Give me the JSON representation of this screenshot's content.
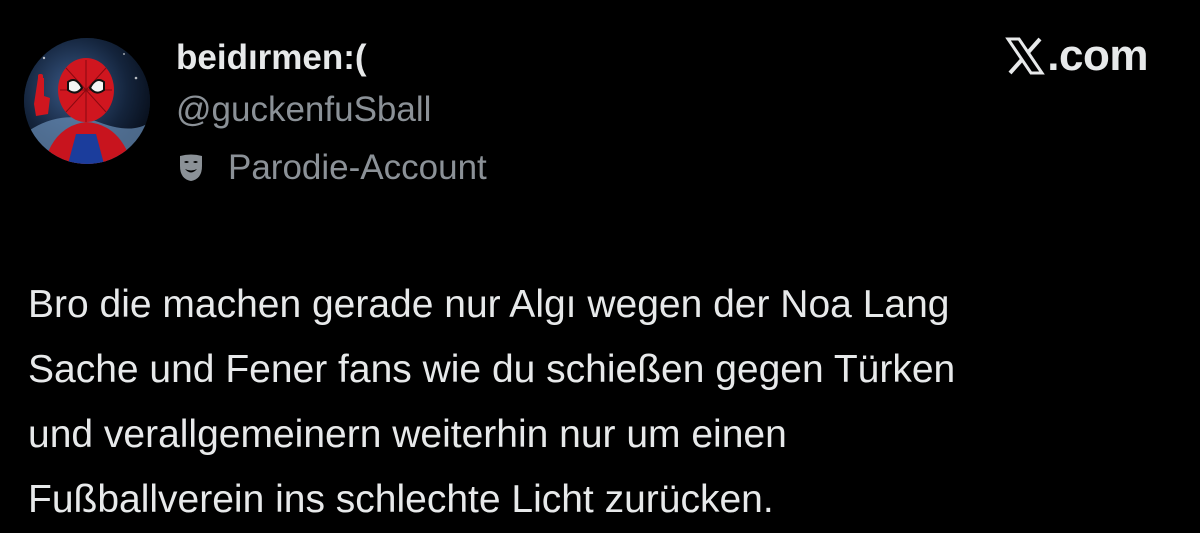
{
  "author": {
    "display_name": "beidırmen:(",
    "handle": "@guckenfuSball",
    "parody_label": "Parodie-Account",
    "avatar_icon": "spiderman-avatar-icon",
    "parody_icon": "theater-mask-icon"
  },
  "brand": {
    "text": ".com",
    "logo_icon": "x-logo-icon"
  },
  "tweet": {
    "lines": [
      "Bro die machen gerade nur Algı wegen der Noa Lang",
      "Sache und Fener fans wie du schießen gegen Türken",
      "und verallgemeinern weiterhin nur um einen",
      "Fußballverein ins schlechte Licht zurücken."
    ]
  },
  "colors": {
    "background": "#000000",
    "primary_text": "#e7e9ea",
    "secondary_text": "#8b9197"
  }
}
